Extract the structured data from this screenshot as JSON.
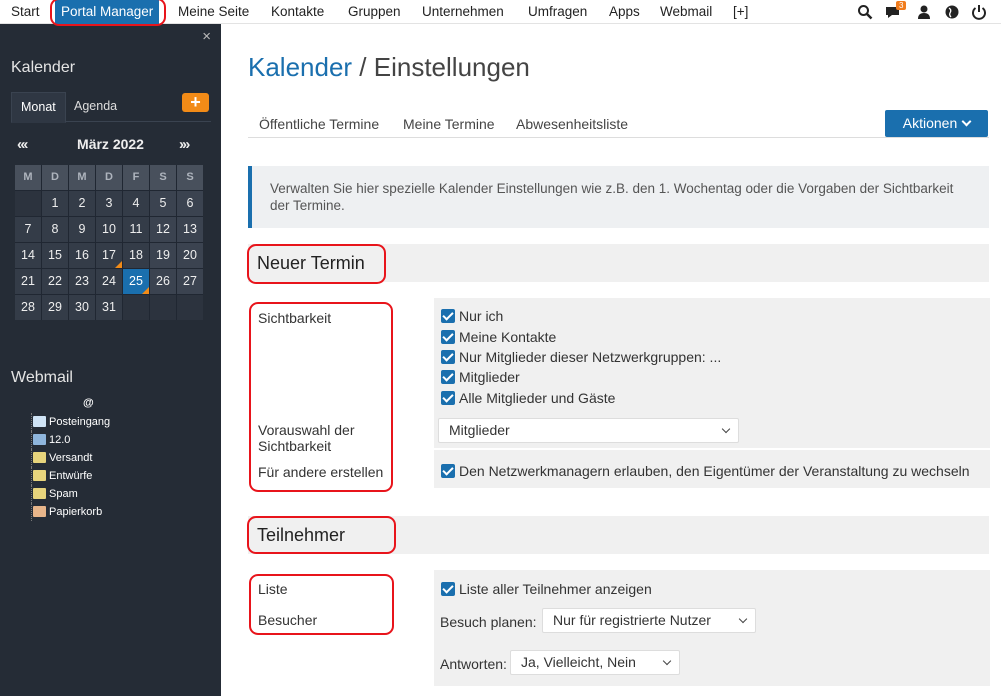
{
  "topnav": {
    "items": [
      "Start",
      "Portal Manager",
      "Meine Seite",
      "Kontakte",
      "Gruppen",
      "Unternehmen",
      "Umfragen",
      "Apps",
      "Webmail",
      "[+]"
    ],
    "notification_count": "3",
    "icons": [
      "search-icon",
      "chat-icon",
      "user-icon",
      "globe-icon",
      "power-icon"
    ]
  },
  "sidebar": {
    "close": "×",
    "calendar_title": "Kalender",
    "tabs": [
      "Monat",
      "Agenda"
    ],
    "add_label": "+",
    "nav_prev": "«‹",
    "nav_next": "›»",
    "month": "März 2022",
    "weekdays": [
      "M",
      "D",
      "M",
      "D",
      "F",
      "S",
      "S"
    ],
    "weeks": [
      [
        "",
        "1",
        "2",
        "3",
        "4",
        "5",
        "6"
      ],
      [
        "7",
        "8",
        "9",
        "10",
        "11",
        "12",
        "13"
      ],
      [
        "14",
        "15",
        "16",
        "17",
        "18",
        "19",
        "20"
      ],
      [
        "21",
        "22",
        "23",
        "24",
        "25",
        "26",
        "27"
      ],
      [
        "28",
        "29",
        "30",
        "31",
        "",
        "",
        ""
      ]
    ],
    "today": "25",
    "marked_days": [
      "17",
      "25"
    ],
    "webmail_title": "Webmail",
    "webmail_root": "@",
    "webmail_folders": [
      {
        "label": "Posteingang",
        "icon": "inbox-icon",
        "color": "#cfe3f5"
      },
      {
        "label": "12.0",
        "icon": "folder-icon",
        "color": "#8fb6dd"
      },
      {
        "label": "Versandt",
        "icon": "sent-icon",
        "color": "#e7d47c"
      },
      {
        "label": "Entwürfe",
        "icon": "drafts-icon",
        "color": "#e7d47c"
      },
      {
        "label": "Spam",
        "icon": "spam-icon",
        "color": "#e7d47c"
      },
      {
        "label": "Papierkorb",
        "icon": "trash-icon",
        "color": "#e7b58a"
      }
    ]
  },
  "main": {
    "title_main": "Kalender",
    "title_sep": " / ",
    "title_sub": "Einstellungen",
    "tabs": [
      "Öffentliche Termine",
      "Meine Termine",
      "Abwesenheitsliste"
    ],
    "actions_label": "Aktionen",
    "info_text": "Verwalten Sie hier spezielle Kalender Einstellungen wie z.B. den 1. Wochentag oder die Vorgaben der Sichtbarkeit der Termine.",
    "section_new": "Neuer Termin",
    "label_visibility": "Sichtbarkeit",
    "visibility_options": [
      "Nur ich",
      "Meine Kontakte",
      "Nur Mitglieder dieser Netzwerkgruppen: ...",
      "Mitglieder",
      "Alle Mitglieder und Gäste"
    ],
    "label_preselect": "Vorauswahl der Sichtbarkeit",
    "preselect_value": "Mitglieder",
    "label_for_others": "Für andere erstellen",
    "for_others_option": "Den Netzwerkmanagern erlauben, den Eigentümer der Veranstaltung zu wechseln",
    "section_participants": "Teilnehmer",
    "label_list": "Liste",
    "list_option": "Liste aller Teilnehmer anzeigen",
    "label_visitors": "Besucher",
    "visit_label": "Besuch planen:",
    "visit_value": "Nur für registrierte Nutzer",
    "answers_label": "Antworten:",
    "answers_value": "Ja, Vielleicht, Nein"
  },
  "colors": {
    "accent": "#1a6fae",
    "sidebar": "#252c36",
    "orange": "#f28b17",
    "highlight": "#e8141b"
  }
}
